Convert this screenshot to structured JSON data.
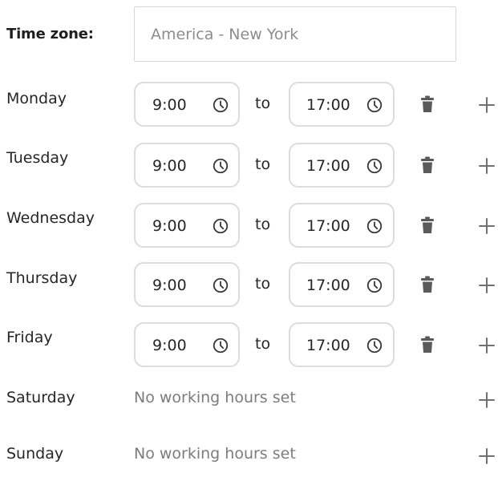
{
  "timezone": {
    "label": "Time zone:",
    "value": "America - New York"
  },
  "connector_label": "to",
  "icons": {
    "clock": "clock-icon",
    "delete": "trash-icon",
    "add": "plus-icon"
  },
  "colors": {
    "text": "#262626",
    "muted": "#7c7c7c",
    "border": "#dcdcdc",
    "icon": "#5a5a5a",
    "plus": "#707070"
  },
  "days": [
    {
      "name": "Monday",
      "start": "9:00",
      "end": "17:00"
    },
    {
      "name": "Tuesday",
      "start": "9:00",
      "end": "17:00"
    },
    {
      "name": "Wednesday",
      "start": "9:00",
      "end": "17:00"
    },
    {
      "name": "Thursday",
      "start": "9:00",
      "end": "17:00"
    },
    {
      "name": "Friday",
      "start": "9:00",
      "end": "17:00"
    },
    {
      "name": "Saturday",
      "empty_text": "No working hours set"
    },
    {
      "name": "Sunday",
      "empty_text": "No working hours set"
    }
  ]
}
